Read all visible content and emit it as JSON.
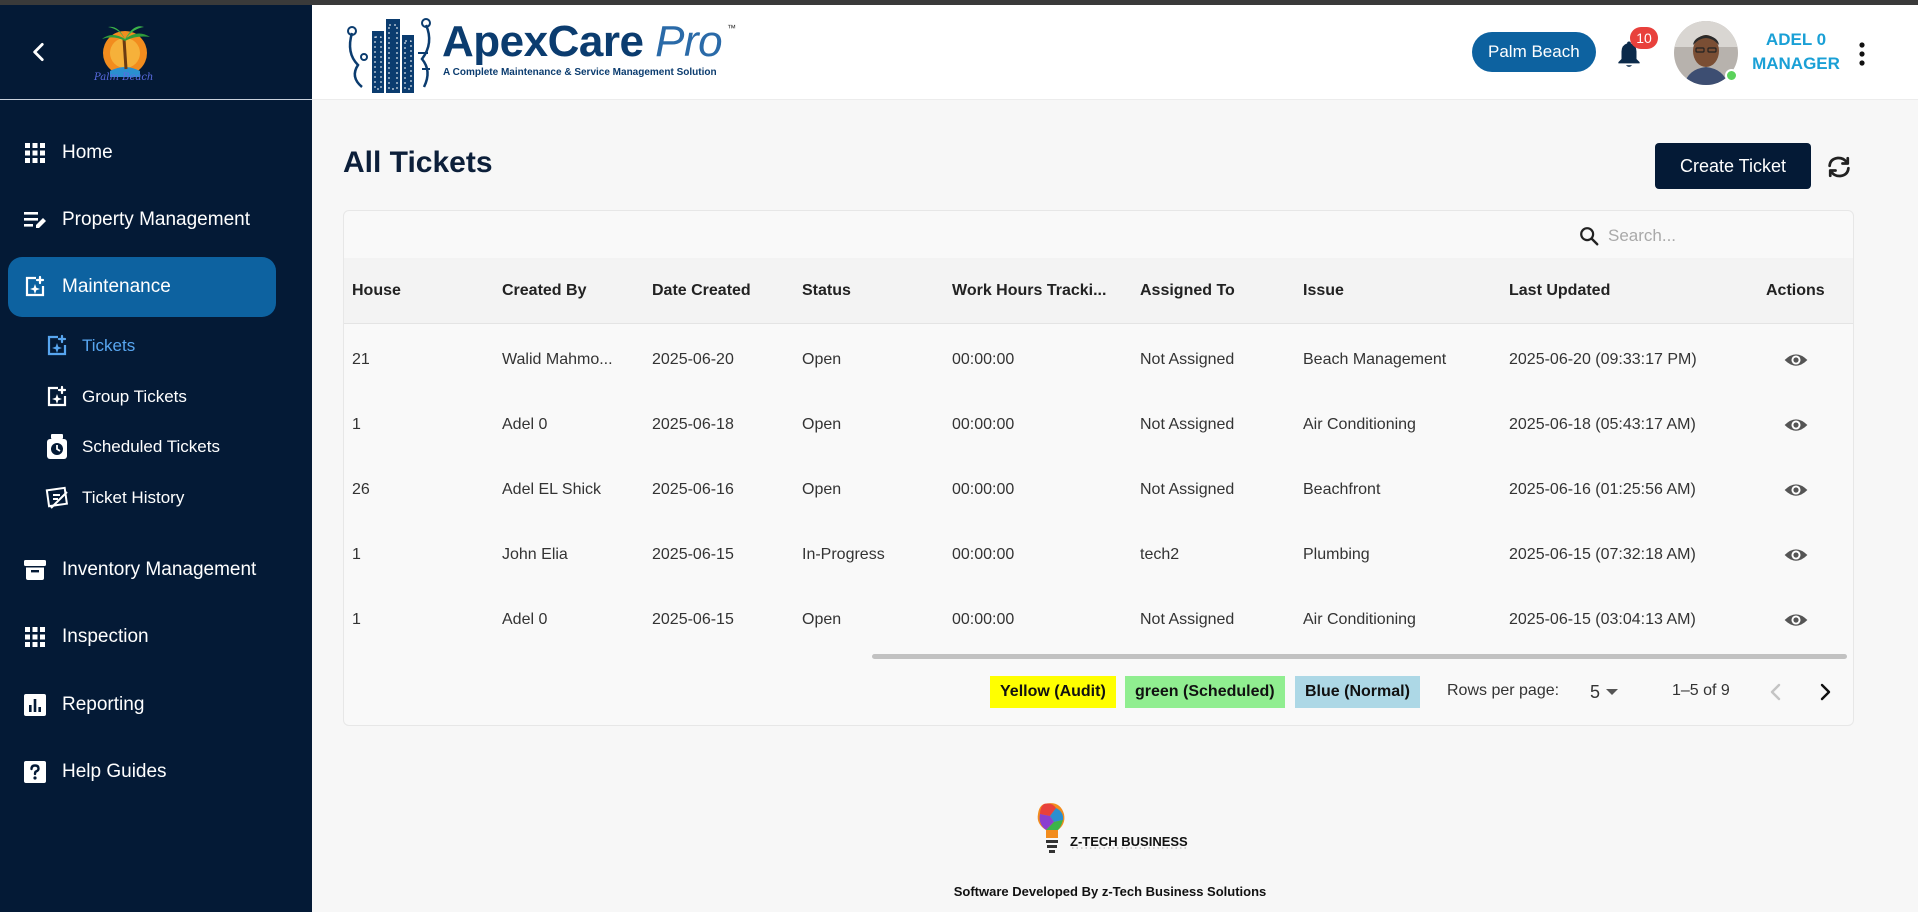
{
  "sidebar": {
    "brand_sub": "Palm Beach",
    "items": [
      {
        "label": "Home",
        "icon": "grid-icon"
      },
      {
        "label": "Property Management",
        "icon": "edit-list-icon"
      },
      {
        "label": "Maintenance",
        "icon": "maintenance-icon",
        "active": true
      },
      {
        "label": "Inventory Management",
        "icon": "archive-icon"
      },
      {
        "label": "Inspection",
        "icon": "grid-icon"
      },
      {
        "label": "Reporting",
        "icon": "bar-chart-icon"
      },
      {
        "label": "Help Guides",
        "icon": "help-icon"
      }
    ],
    "sub_items": [
      {
        "label": "Tickets",
        "icon": "ticket-icon",
        "active": true
      },
      {
        "label": "Group Tickets",
        "icon": "group-ticket-icon"
      },
      {
        "label": "Scheduled Tickets",
        "icon": "scheduled-icon"
      },
      {
        "label": "Ticket History",
        "icon": "history-icon"
      }
    ]
  },
  "header": {
    "logo_main": "ApexCare",
    "logo_pro": "Pro",
    "logo_tm": "™",
    "logo_tagline": "A Complete Maintenance & Service Management Solution",
    "location": "Palm Beach",
    "notification_count": "10",
    "user_name": "ADEL 0",
    "user_role": "MANAGER"
  },
  "main": {
    "title": "All Tickets",
    "create_button": "Create Ticket",
    "search_placeholder": "Search...",
    "columns": [
      "House",
      "Created By",
      "Date Created",
      "Status",
      "Work Hours Tracki...",
      "Assigned To",
      "Issue",
      "Last Updated",
      "Actions"
    ],
    "rows": [
      [
        "21",
        "Walid Mahmo...",
        "2025-06-20",
        "Open",
        "00:00:00",
        "Not Assigned",
        "Beach Management",
        "2025-06-20 (09:33:17 PM)"
      ],
      [
        "1",
        "Adel 0",
        "2025-06-18",
        "Open",
        "00:00:00",
        "Not Assigned",
        "Air Conditioning",
        "2025-06-18 (05:43:17 AM)"
      ],
      [
        "26",
        "Adel EL Shick",
        "2025-06-16",
        "Open",
        "00:00:00",
        "Not Assigned",
        "Beachfront",
        "2025-06-16 (01:25:56 AM)"
      ],
      [
        "1",
        "John Elia",
        "2025-06-15",
        "In-Progress",
        "00:00:00",
        "tech2",
        "Plumbing",
        "2025-06-15 (07:32:18 AM)"
      ],
      [
        "1",
        "Adel 0",
        "2025-06-15",
        "Open",
        "00:00:00",
        "Not Assigned",
        "Air Conditioning",
        "2025-06-15 (03:04:13 AM)"
      ]
    ],
    "legend": [
      {
        "label": "Yellow (Audit)",
        "color": "#ffff00"
      },
      {
        "label": "green (Scheduled)",
        "color": "#90ee90"
      },
      {
        "label": "Blue (Normal)",
        "color": "#add8e6"
      }
    ],
    "rows_per_page_label": "Rows per page:",
    "rows_per_page": "5",
    "range": "1–5 of 9"
  },
  "footer": {
    "brand": "Z-TECH BUSINESS",
    "credit": "Software Developed By z-Tech Business Solutions"
  },
  "colors": {
    "sidebar_bg": "#041a36",
    "accent": "#0d62a0",
    "active_sub": "#58a6f0",
    "notification": "#e8413c"
  }
}
